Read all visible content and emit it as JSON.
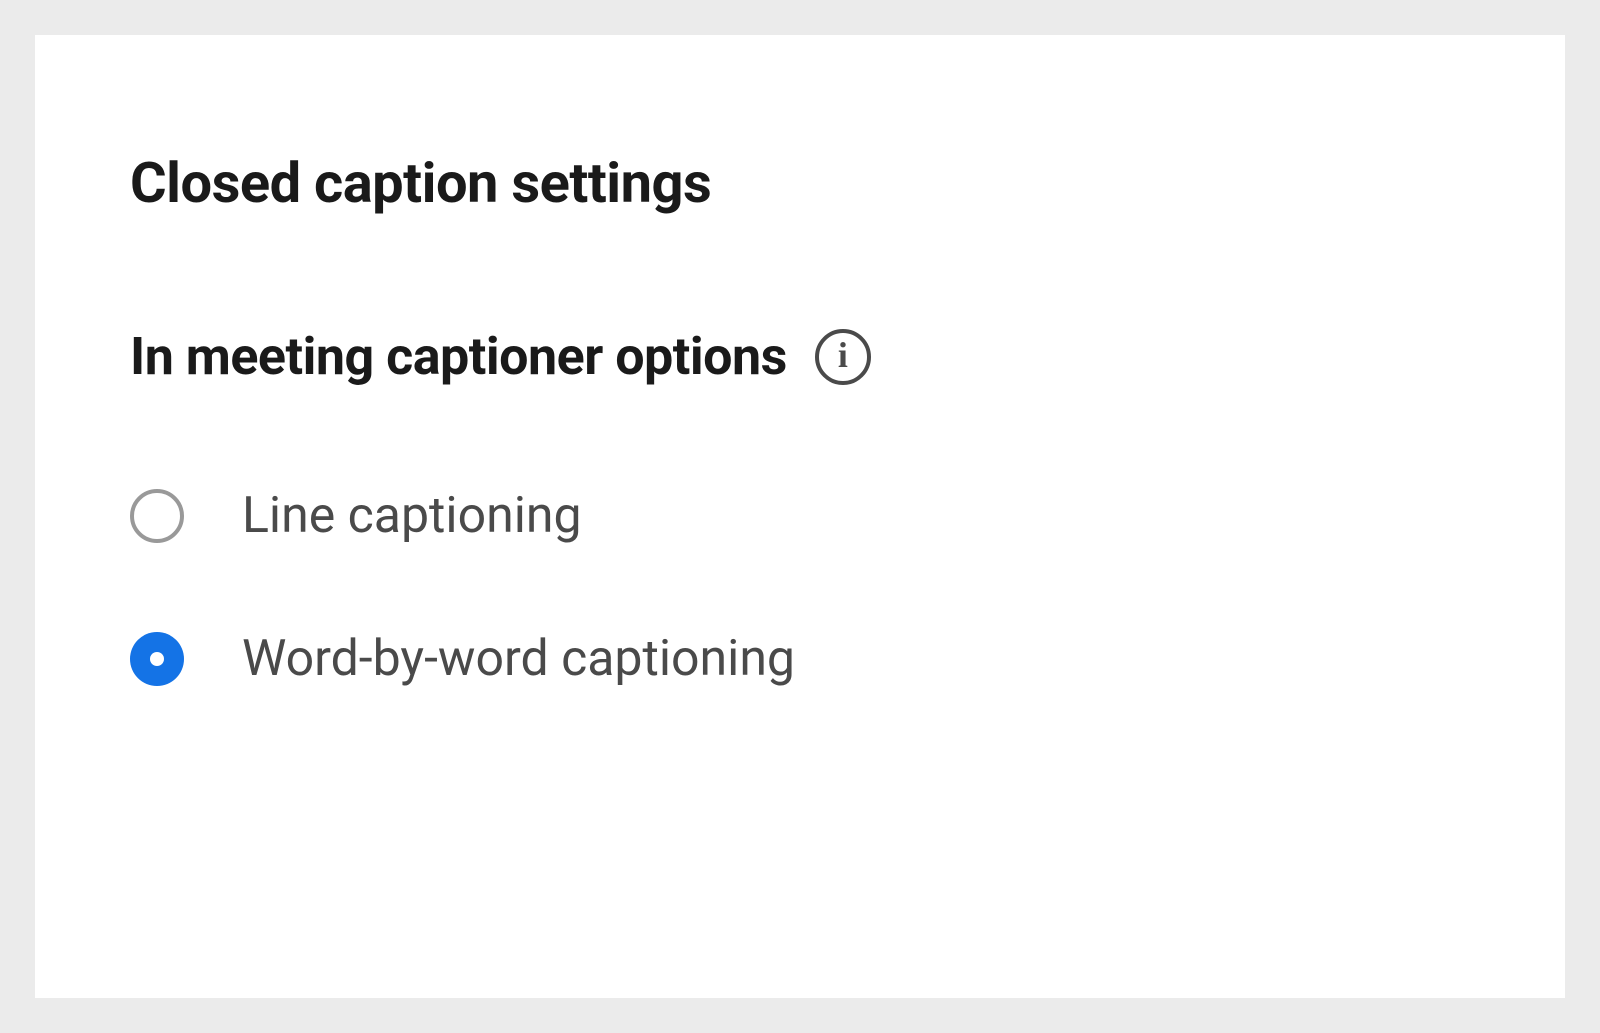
{
  "heading": "Closed caption settings",
  "subheading": "In meeting captioner options",
  "options": [
    {
      "label": "Line captioning",
      "selected": false
    },
    {
      "label": "Word-by-word captioning",
      "selected": true
    }
  ]
}
